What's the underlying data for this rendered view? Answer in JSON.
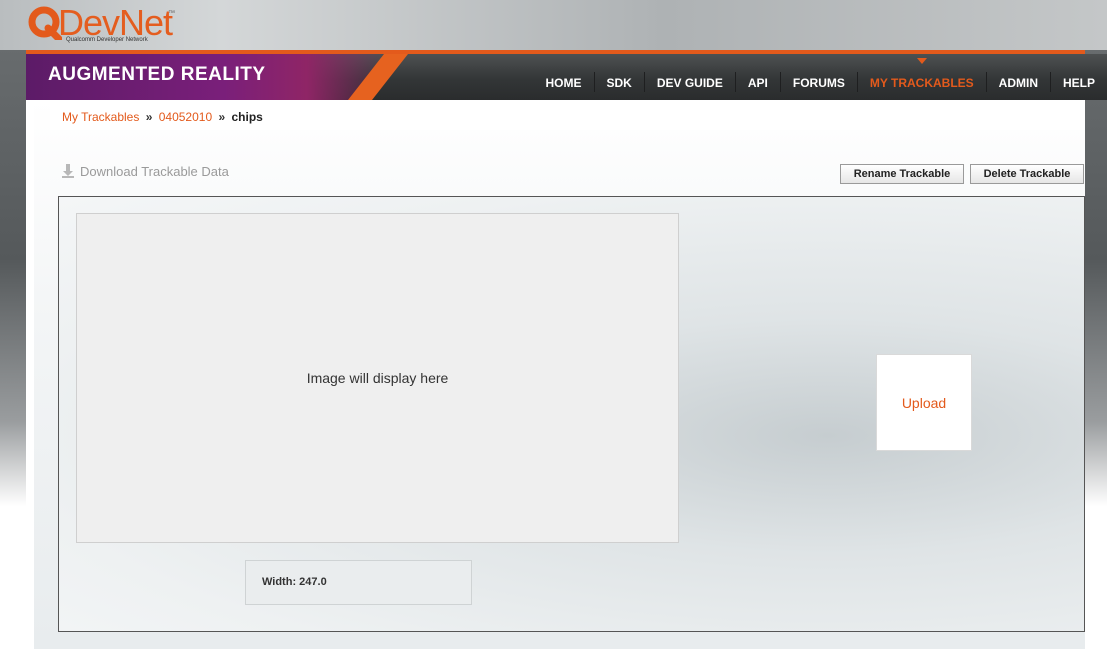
{
  "logo": {
    "brand_q": "Q",
    "brand_text": "DevNet",
    "tm": "™",
    "subtitle": "Qualcomm Developer Network"
  },
  "nav": {
    "brand": "AUGMENTED REALITY",
    "items": [
      {
        "label": "HOME",
        "active": false
      },
      {
        "label": "SDK",
        "active": false
      },
      {
        "label": "DEV GUIDE",
        "active": false
      },
      {
        "label": "API",
        "active": false
      },
      {
        "label": "FORUMS",
        "active": false
      },
      {
        "label": "MY TRACKABLES",
        "active": true
      },
      {
        "label": "ADMIN",
        "active": false
      },
      {
        "label": "HELP",
        "active": false
      }
    ]
  },
  "breadcrumb": {
    "items": [
      "My Trackables",
      "04052010"
    ],
    "separator": "»",
    "current": "chips"
  },
  "actions": {
    "download_label": "Download Trackable Data",
    "rename_label": "Rename Trackable",
    "delete_label": "Delete Trackable"
  },
  "main": {
    "image_placeholder": "Image will display here",
    "width_text": "Width: 247.0",
    "upload_label": "Upload"
  },
  "colors": {
    "accent": "#e35a1c",
    "brand_purple": "#7a1f7a",
    "nav_dark": "#333637"
  },
  "icons": {
    "download": "download-arrow-icon",
    "logo": "qualcomm-q-logo-icon"
  }
}
